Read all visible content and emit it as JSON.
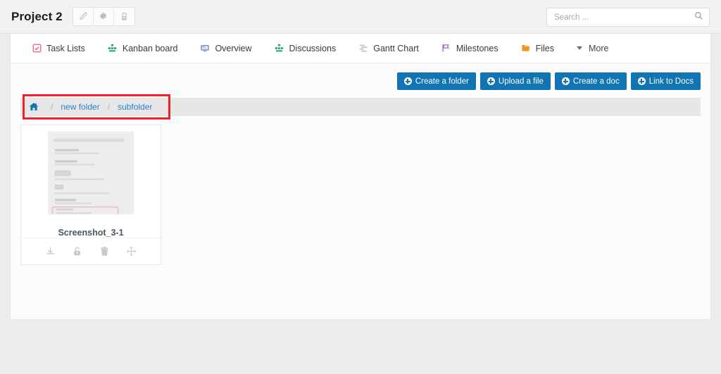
{
  "header": {
    "project_title": "Project 2",
    "title_buttons": [
      {
        "name": "edit-project-button",
        "icon": "pencil-icon"
      },
      {
        "name": "project-settings-button",
        "icon": "gear-icon"
      },
      {
        "name": "project-notes-button",
        "icon": "document-icon"
      }
    ],
    "search": {
      "placeholder": "Search ...",
      "value": "",
      "icon": "search-icon"
    }
  },
  "nav": {
    "tabs": [
      {
        "label": "Task Lists",
        "icon": "checkbox-square-icon",
        "color": "#ef5b6b"
      },
      {
        "label": "Kanban board",
        "icon": "kanban-icon",
        "color": "#23a57f"
      },
      {
        "label": "Overview",
        "icon": "monitor-icon",
        "color": "#6d7dd6"
      },
      {
        "label": "Discussions",
        "icon": "discussions-icon",
        "color": "#23a57f"
      },
      {
        "label": "Gantt Chart",
        "icon": "gantt-bars-icon",
        "color": "#b8bcc2"
      },
      {
        "label": "Milestones",
        "icon": "flag-icon",
        "color": "#9b59d0"
      },
      {
        "label": "Files",
        "icon": "folder-icon",
        "color": "#f0941f"
      }
    ],
    "more_label": "More",
    "more_icon": "caret-down-icon"
  },
  "toolbar": {
    "buttons": [
      {
        "label": "Create a folder",
        "name": "create-a-folder-button"
      },
      {
        "label": "Upload a file",
        "name": "upload-a-file-button"
      },
      {
        "label": "Create a doc",
        "name": "create-a-doc-button"
      },
      {
        "label": "Link to Docs",
        "name": "link-to-docs-button"
      }
    ],
    "accent_color": "#1175b3"
  },
  "breadcrumb": {
    "home_icon": "home-icon",
    "separator": "/",
    "items": [
      {
        "label": "new folder"
      },
      {
        "label": "subfolder"
      }
    ],
    "highlight_color": "#ec2227"
  },
  "files": [
    {
      "name": "Screenshot_3-1",
      "thumbnail_alt": "document-screenshot-thumbnail",
      "actions": [
        {
          "name": "download-icon",
          "label": "Download"
        },
        {
          "name": "lock-icon",
          "label": "Lock"
        },
        {
          "name": "trash-icon",
          "label": "Delete"
        },
        {
          "name": "move-icon",
          "label": "Move"
        }
      ]
    }
  ]
}
